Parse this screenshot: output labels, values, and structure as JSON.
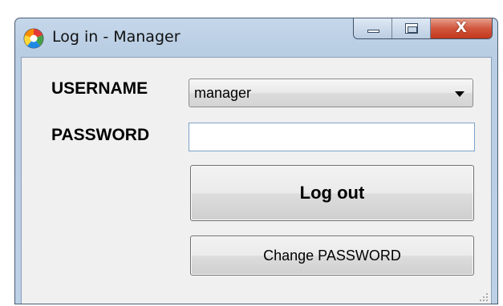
{
  "window": {
    "title": "Log in - Manager"
  },
  "form": {
    "username_label": "USERNAME",
    "username_value": "manager",
    "password_label": "PASSWORD",
    "password_value": ""
  },
  "buttons": {
    "logout_label": "Log out",
    "change_password_label": "Change PASSWORD",
    "close_label": "X"
  },
  "icons": {
    "app": "app-logo-icon",
    "minimize": "minimize-icon",
    "maximize": "maximize-icon",
    "close": "close-icon",
    "dropdown": "chevron-down-icon",
    "resize": "resize-grip-icon"
  },
  "colors": {
    "titlebar": "#c5d7ea",
    "close_button": "#c2371b",
    "client_background": "#f0f0f0"
  }
}
